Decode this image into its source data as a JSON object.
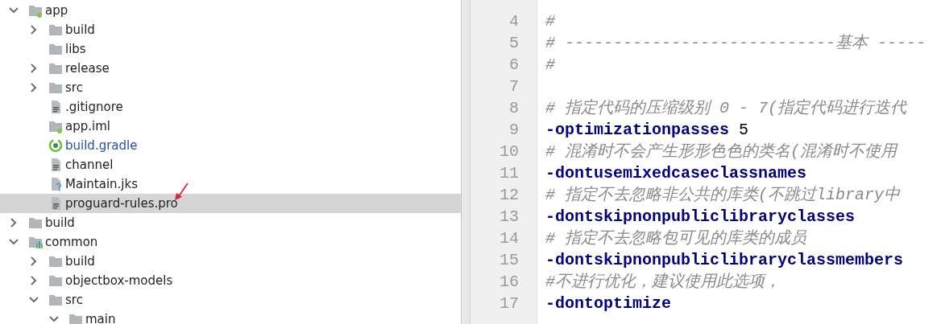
{
  "project_tree": [
    {
      "label": "app",
      "kind": "module",
      "expanded": true,
      "selected": false,
      "children": [
        {
          "label": "build",
          "kind": "folder",
          "expanded": false,
          "selected": false
        },
        {
          "label": "libs",
          "kind": "folder",
          "selected": false
        },
        {
          "label": "release",
          "kind": "folder",
          "expanded": false,
          "selected": false
        },
        {
          "label": "src",
          "kind": "folder",
          "expanded": false,
          "selected": false
        },
        {
          "label": ".gitignore",
          "kind": "textfile",
          "selected": false
        },
        {
          "label": "app.iml",
          "kind": "module",
          "selected": false
        },
        {
          "label": "build.gradle",
          "kind": "gradle",
          "selected": false,
          "color": "#2250b0"
        },
        {
          "label": "channel",
          "kind": "textfile",
          "selected": false
        },
        {
          "label": "Maintain.jks",
          "kind": "unknown",
          "selected": false
        },
        {
          "label": "proguard-rules.pro",
          "kind": "textfile",
          "selected": true
        }
      ]
    },
    {
      "label": "build",
      "kind": "folder",
      "expanded": false,
      "selected": false
    },
    {
      "label": "common",
      "kind": "library",
      "expanded": true,
      "selected": false,
      "children": [
        {
          "label": "build",
          "kind": "folder",
          "expanded": false,
          "selected": false
        },
        {
          "label": "objectbox-models",
          "kind": "folder",
          "expanded": false,
          "selected": false
        },
        {
          "label": "src",
          "kind": "folder",
          "expanded": true,
          "selected": false,
          "children": [
            {
              "label": "main",
              "kind": "folder",
              "expanded": true,
              "selected": false
            }
          ]
        }
      ]
    }
  ],
  "editor": {
    "lines": [
      {
        "number": "4",
        "kind": "comment",
        "text": "#"
      },
      {
        "number": "5",
        "kind": "comment",
        "text": "# ----------------------------基本 -----"
      },
      {
        "number": "6",
        "kind": "comment",
        "text": "#"
      },
      {
        "number": "7",
        "kind": "blank"
      },
      {
        "number": "8",
        "kind": "comment",
        "text": "# 指定代码的压缩级别 0 - 7(指定代码进行迭代"
      },
      {
        "number": "9",
        "kind": "option",
        "text": "-optimizationpasses",
        "argument": "5"
      },
      {
        "number": "10",
        "kind": "comment",
        "text": "# 混淆时不会产生形形色色的类名(混淆时不使用"
      },
      {
        "number": "11",
        "kind": "option",
        "text": "-dontusemixedcaseclassnames"
      },
      {
        "number": "12",
        "kind": "comment",
        "text": "# 指定不去忽略非公共的库类(不跳过library中"
      },
      {
        "number": "13",
        "kind": "option",
        "text": "-dontskipnonpubliclibraryclasses"
      },
      {
        "number": "14",
        "kind": "comment",
        "text": "# 指定不去忽略包可见的库类的成员"
      },
      {
        "number": "15",
        "kind": "option",
        "text": "-dontskipnonpubliclibraryclassmembers"
      },
      {
        "number": "16",
        "kind": "comment",
        "text": "#不进行优化，建议使用此选项，"
      },
      {
        "number": "17",
        "kind": "option",
        "text": "-dontoptimize"
      }
    ]
  }
}
